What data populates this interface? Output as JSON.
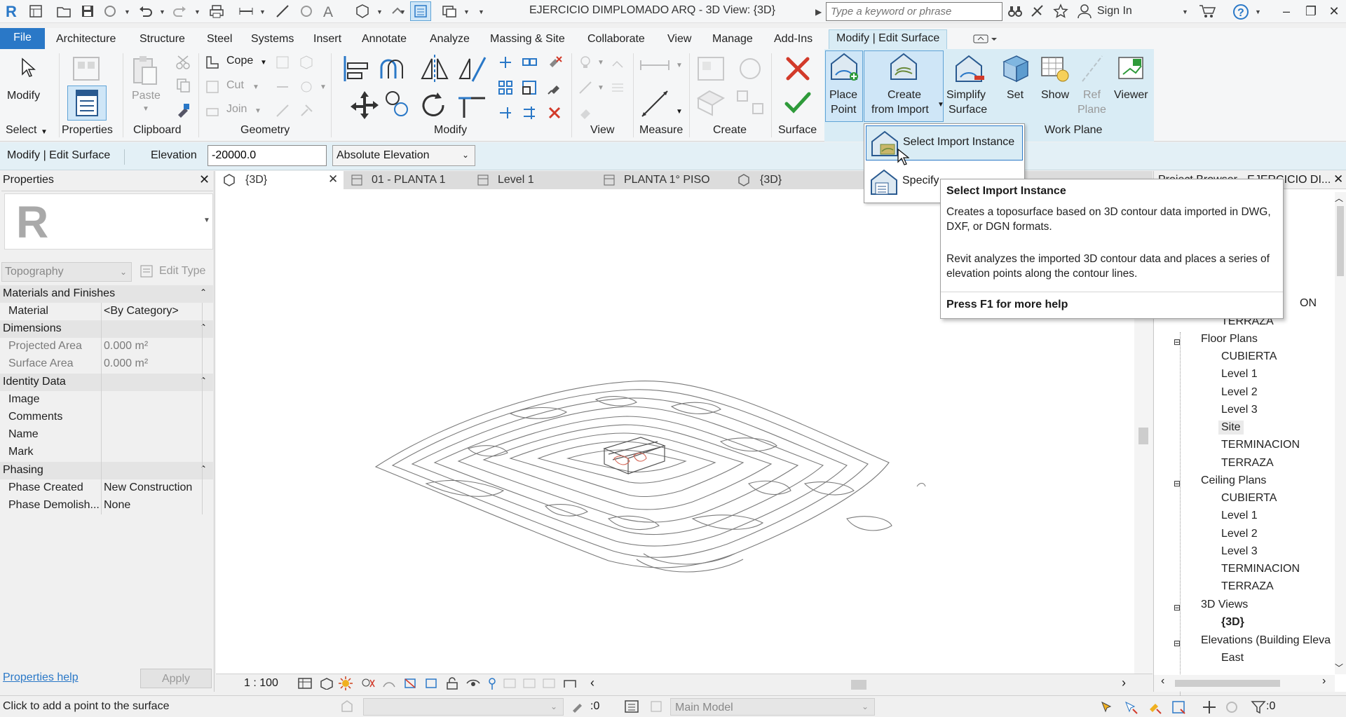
{
  "title_bar": {
    "app_title": "EJERCICIO DIMPLOMADO ARQ - 3D View: {3D}",
    "search_placeholder": "Type a keyword or phrase",
    "sign_in": "Sign In"
  },
  "ribbon_tabs": [
    "File",
    "Architecture",
    "Structure",
    "Steel",
    "Systems",
    "Insert",
    "Annotate",
    "Analyze",
    "Massing & Site",
    "Collaborate",
    "View",
    "Manage",
    "Add-Ins",
    "Modify | Edit Surface"
  ],
  "ribbon": {
    "modify": "Modify",
    "select": "Select",
    "properties": "Properties",
    "paste": "Paste",
    "clipboard": "Clipboard",
    "cope": "Cope",
    "cut": "Cut",
    "join": "Join",
    "geometry": "Geometry",
    "modify_group": "Modify",
    "view_group": "View",
    "measure_group": "Measure",
    "create_group": "Create",
    "surface_group": "Surface",
    "place_point_1": "Place",
    "place_point_2": "Point",
    "create_import_1": "Create",
    "create_import_2": "from Import",
    "simplify_1": "Simplify",
    "simplify_2": "Surface",
    "set": "Set",
    "show": "Show",
    "ref_plane_1": "Ref",
    "ref_plane_2": "Plane",
    "viewer": "Viewer",
    "work_plane_group": "Work Plane"
  },
  "options_bar": {
    "context": "Modify | Edit Surface",
    "elevation_label": "Elevation",
    "elevation_value": "-20000.0",
    "elevation_mode": "Absolute Elevation"
  },
  "dropdown": {
    "item1": "Select Import Instance",
    "item2": "Specify"
  },
  "tooltip": {
    "title": "Select Import Instance",
    "para1": "Creates a toposurface based on 3D contour data imported in DWG, DXF, or DGN formats.",
    "para2": "Revit analyzes the imported 3D contour data and places a series of elevation points along the contour lines.",
    "footer": "Press F1 for more help"
  },
  "properties": {
    "title": "Properties",
    "type_selector": "Topography",
    "edit_type": "Edit Type",
    "cat_materials": "Materials and Finishes",
    "material_k": "Material",
    "material_v": "<By Category>",
    "cat_dimensions": "Dimensions",
    "proj_area_k": "Projected Area",
    "proj_area_v": "0.000 m²",
    "surf_area_k": "Surface Area",
    "surf_area_v": "0.000 m²",
    "cat_identity": "Identity Data",
    "image_k": "Image",
    "comments_k": "Comments",
    "name_k": "Name",
    "mark_k": "Mark",
    "cat_phasing": "Phasing",
    "phase_created_k": "Phase Created",
    "phase_created_v": "New Construction",
    "phase_demo_k": "Phase Demolish...",
    "phase_demo_v": "None",
    "help_link": "Properties help",
    "apply": "Apply"
  },
  "view_tabs": [
    "{3D}",
    "01 - PLANTA 1",
    "Level 1",
    "PLANTA 1° PISO",
    "{3D}"
  ],
  "view_control": {
    "scale": "1 : 100"
  },
  "browser": {
    "header": "Project Browser - EJERCICIO DI...",
    "partial_on": "ON",
    "terraza_top": "TERRAZA",
    "floor_plans": "Floor Plans",
    "fp_items": [
      "CUBIERTA",
      "Level 1",
      "Level 2",
      "Level 3",
      "Site",
      "TERMINACION",
      "TERRAZA"
    ],
    "ceiling_plans": "Ceiling Plans",
    "cp_items": [
      "CUBIERTA",
      "Level 1",
      "Level 2",
      "Level 3",
      "TERMINACION",
      "TERRAZA"
    ],
    "views_3d": "3D Views",
    "v3d_items": [
      "{3D}"
    ],
    "elevations": "Elevations (Building Eleva",
    "el_items": [
      "East"
    ]
  },
  "status_bar": {
    "message": "Click to add a point to the surface",
    "coord": ":0",
    "model": "Main Model",
    "filter": ":0"
  },
  "colors": {
    "accent": "#2a78c7",
    "contextual_tab": "#d9ecf5",
    "canvas": "#ffffff"
  }
}
